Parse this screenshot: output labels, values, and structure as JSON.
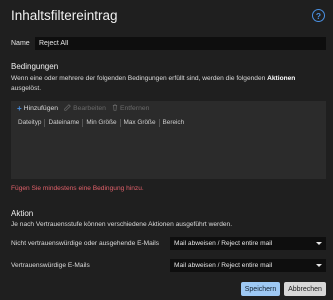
{
  "dialog": {
    "title": "Inhaltsfiltereintrag",
    "help_icon": "question-circle-icon"
  },
  "name": {
    "label": "Name",
    "value": "Reject All"
  },
  "conditions": {
    "heading": "Bedingungen",
    "desc_prefix": "Wenn eine oder mehrere der folgenden Bedingungen erfüllt sind, werden die folgenden ",
    "desc_bold": "Aktionen",
    "desc_suffix": " ausgelöst.",
    "toolbar": {
      "add": "Hinzufügen",
      "edit": "Bearbeiten",
      "remove": "Entfernen"
    },
    "columns": [
      "Dateityp",
      "Dateiname",
      "Min Größe",
      "Max Größe",
      "Bereich"
    ],
    "error": "Fügen Sie mindestens eine Bedingung hinzu."
  },
  "action": {
    "heading": "Aktion",
    "desc": "Je nach Vertrauensstufe können verschiedene Aktionen ausgeführt werden.",
    "rows": [
      {
        "label": "Nicht vertrauenswürdige oder ausgehende E-Mails",
        "selected": "Mail abweisen / Reject entire mail"
      },
      {
        "label": "Vertrauenswürdige E-Mails",
        "selected": "Mail abweisen / Reject entire mail"
      }
    ]
  },
  "footer": {
    "save": "Speichern",
    "cancel": "Abbrechen"
  },
  "colors": {
    "accent": "#4a90e2",
    "error": "#e0606a",
    "background": "#1f1f1f"
  }
}
